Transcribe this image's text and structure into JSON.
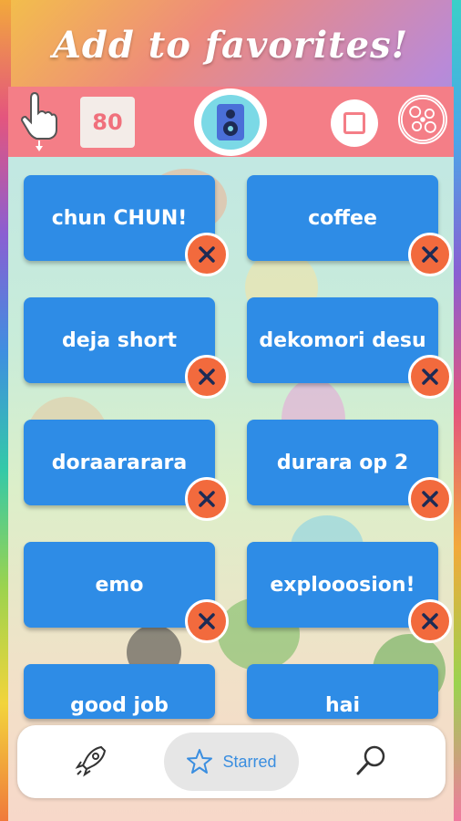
{
  "headline": "Add to favorites!",
  "topbar": {
    "counter_value": "80",
    "icons": [
      "tap-hand-icon",
      "speaker-icon",
      "stop-icon",
      "pattern-icon"
    ],
    "color": "#f47e87"
  },
  "sounds": [
    {
      "label": "chun CHUN!"
    },
    {
      "label": "coffee"
    },
    {
      "label": "deja short"
    },
    {
      "label": "dekomori desu"
    },
    {
      "label": "doraararara"
    },
    {
      "label": "durara op 2"
    },
    {
      "label": "emo"
    },
    {
      "label": "explooosion!"
    },
    {
      "label": "good job"
    },
    {
      "label": "hai"
    }
  ],
  "tile_color": "#2e8ce6",
  "remove_color": "#f26a3d",
  "bottom_nav": {
    "items": [
      {
        "icon": "rocket-icon",
        "label": ""
      },
      {
        "icon": "star-icon",
        "label": "Starred",
        "active": true
      },
      {
        "icon": "search-icon",
        "label": ""
      }
    ],
    "accent": "#3a8ee0"
  }
}
